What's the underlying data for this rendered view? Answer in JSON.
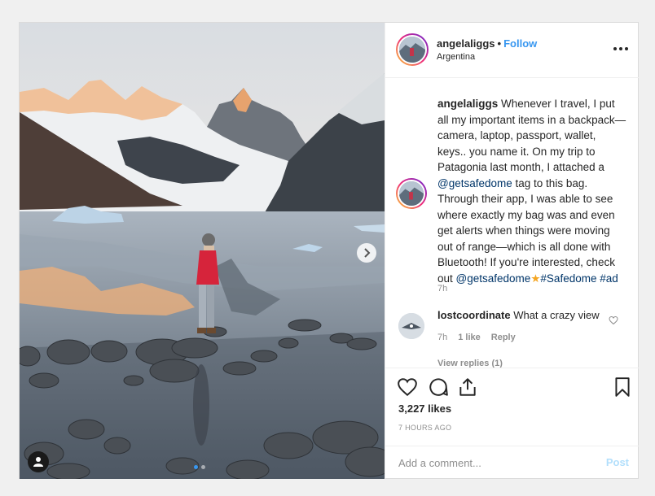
{
  "post": {
    "username": "angelaliggs",
    "follow_label": "Follow",
    "separator": "•",
    "location": "Argentina",
    "more_icon": "more-horizontal-icon",
    "caption": {
      "username": "angelaliggs",
      "text_1": "Whenever I travel, I put all my important items in a backpack—camera, laptop, passport, wallet, keys.. you name it. On my trip to Patagonia last month, I attached a",
      "mention_1": "@getsafedome",
      "text_2": "tag to this bag. Through their app, I was able to see where exactly my bag was and even get alerts when things were moving out of range—which is all done with Bluetooth! If you're interested, check out",
      "mention_2": "@getsafedome",
      "star": "★",
      "hashtag_1": "#Safedome",
      "hashtag_2": "#ad",
      "time": "7h"
    },
    "comment": {
      "username": "lostcoordinate",
      "text": "What a crazy view",
      "time": "7h",
      "likes": "1 like",
      "reply_label": "Reply",
      "view_replies": "View replies (1)"
    },
    "likes_count": "3,227 likes",
    "time_ago": "7 HOURS AGO",
    "comment_placeholder": "Add a comment...",
    "post_label": "Post"
  },
  "carousel": {
    "total": 2,
    "active": 1
  },
  "colors": {
    "link": "#3897f0",
    "mention": "#003569",
    "muted": "#8e8e8e",
    "post_disabled": "#b2dffc"
  }
}
